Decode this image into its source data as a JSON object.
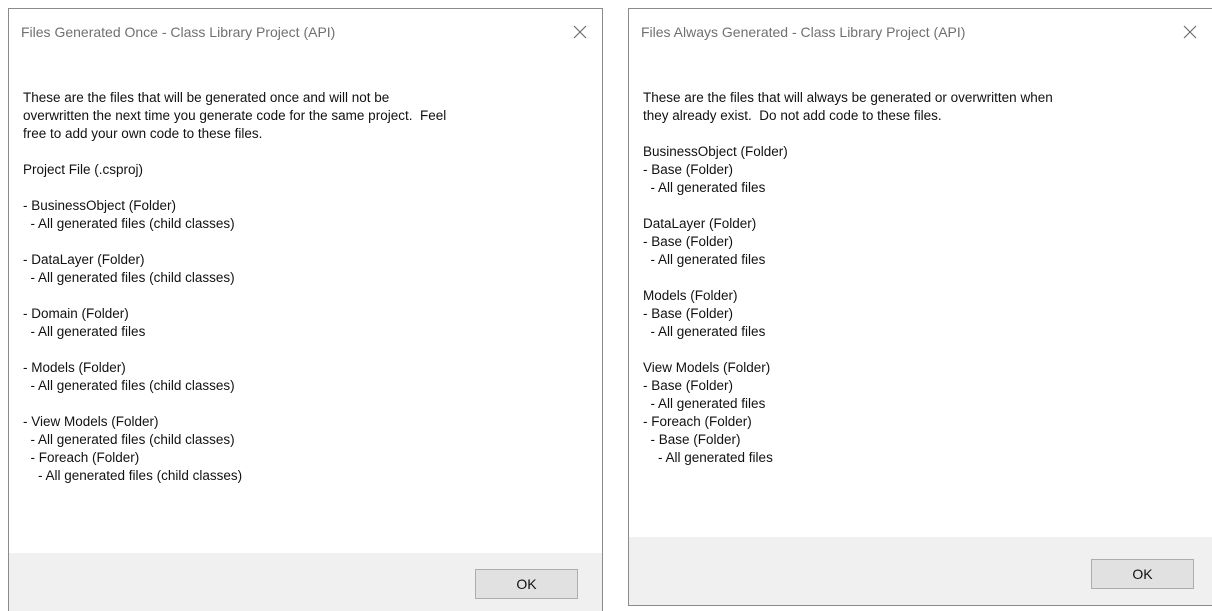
{
  "left_dialog": {
    "title": "Files Generated Once - Class Library Project (API)",
    "lines": [
      "These are the files that will be generated once and will not be",
      "overwritten the next time you generate code for the same project.  Feel",
      "free to add your own code to these files.",
      "",
      "Project File (.csproj)",
      "",
      "- BusinessObject (Folder)",
      "  - All generated files (child classes)",
      "",
      "- DataLayer (Folder)",
      "  - All generated files (child classes)",
      "",
      "- Domain (Folder)",
      "  - All generated files",
      "",
      "- Models (Folder)",
      "  - All generated files (child classes)",
      "",
      "- View Models (Folder)",
      "  - All generated files (child classes)",
      "  - Foreach (Folder)",
      "    - All generated files (child classes)"
    ],
    "ok_label": "OK"
  },
  "right_dialog": {
    "title": "Files Always Generated - Class Library Project (API)",
    "lines": [
      "These are the files that will always be generated or overwritten when",
      "they already exist.  Do not add code to these files.",
      "",
      "BusinessObject (Folder)",
      "- Base (Folder)",
      "  - All generated files",
      "",
      "DataLayer (Folder)",
      "- Base (Folder)",
      "  - All generated files",
      "",
      "Models (Folder)",
      "- Base (Folder)",
      "  - All generated files",
      "",
      "View Models (Folder)",
      "- Base (Folder)",
      "  - All generated files",
      "- Foreach (Folder)",
      "  - Base (Folder)",
      "    - All generated files"
    ],
    "ok_label": "OK"
  },
  "icons": {
    "close": "close-icon"
  }
}
